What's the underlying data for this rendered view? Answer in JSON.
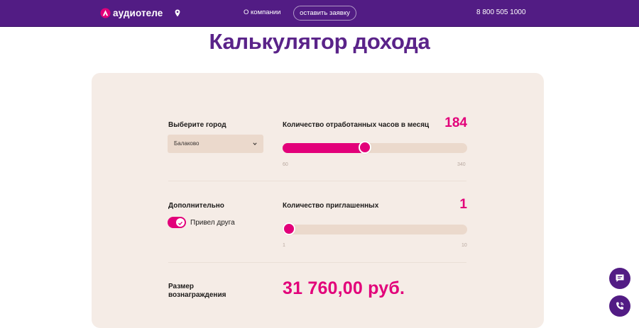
{
  "header": {
    "logo_text": "аудиотеле",
    "nav_about": "О компании",
    "nav_request": "оставить заявку",
    "phone": "8 800 505 1000",
    "bg_color": "#521c84"
  },
  "page": {
    "title": "Калькулятор дохода"
  },
  "calculator": {
    "city": {
      "label": "Выберите город",
      "selected": "Балаково"
    },
    "hours": {
      "label": "Количество отработанных часов в месяц",
      "value": "184",
      "min": "60",
      "max": "340",
      "fraction": 0.443
    },
    "extra": {
      "label": "Дополнительно",
      "toggle_label": "Привел друга",
      "toggle_on": true
    },
    "invited": {
      "label": "Количество приглашенных",
      "value": "1",
      "min": "1",
      "max": "10",
      "fraction": 0.0
    },
    "reward": {
      "label": "Размер вознаграждения",
      "value": "31 760,00 руб."
    },
    "accent_color": "#e2007a"
  },
  "icons": {
    "geo": "map-pin-icon",
    "chat": "chat-bubble-icon",
    "call": "phone-call-icon"
  }
}
